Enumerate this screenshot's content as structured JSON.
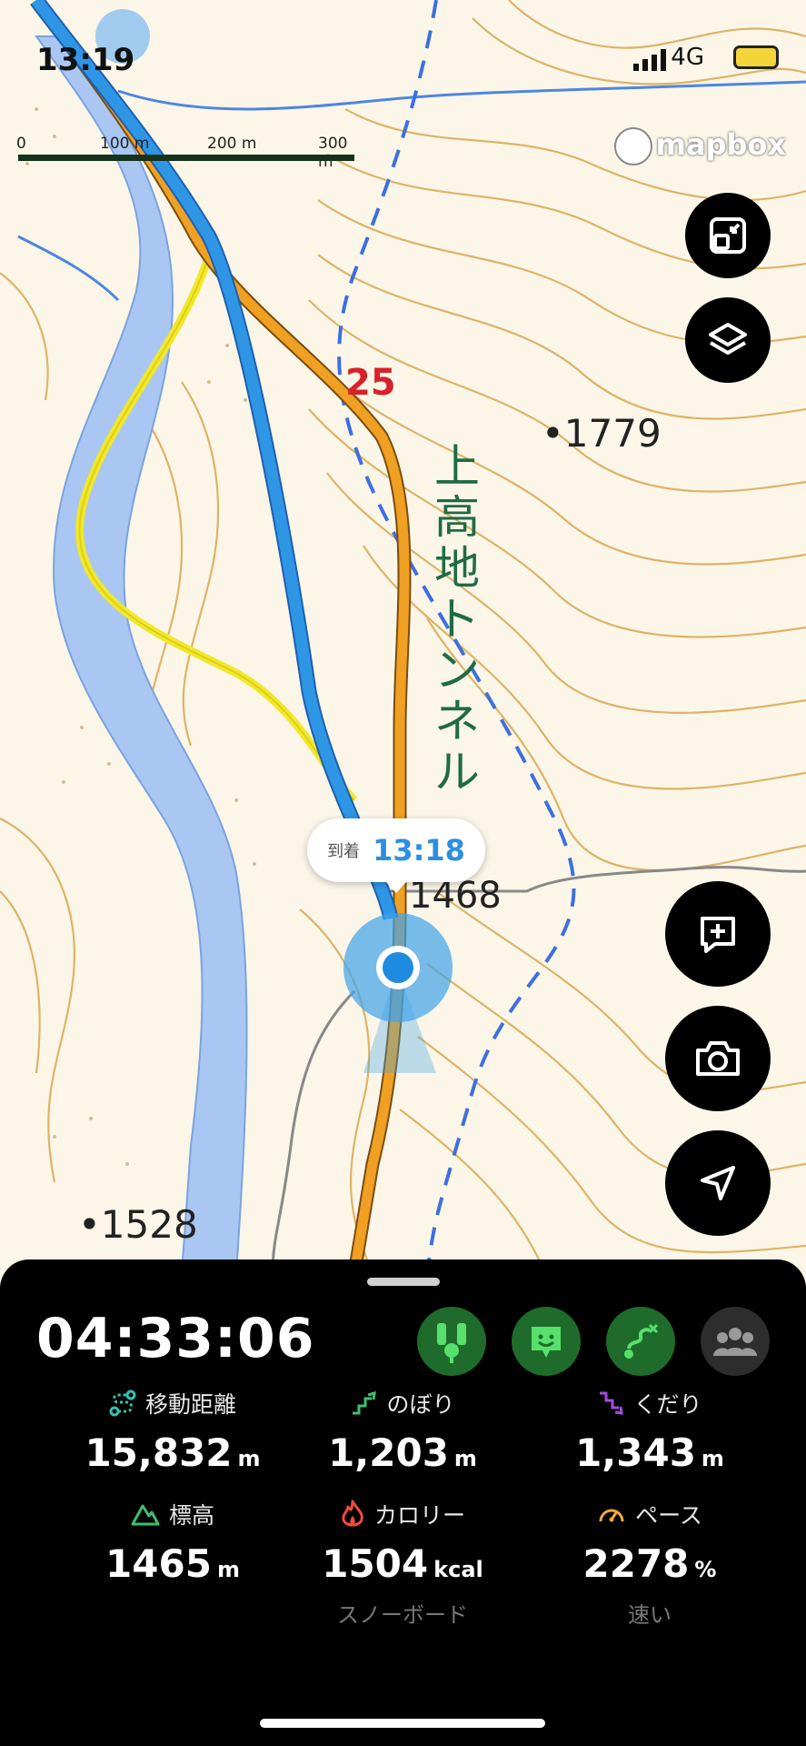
{
  "status_bar": {
    "time": "13:19",
    "network": "4G"
  },
  "scale_bar": {
    "labels": [
      "0",
      "100 m",
      "200 m",
      "300 m"
    ]
  },
  "map": {
    "attribution": "mapbox",
    "labels": {
      "route_number": "25",
      "elevation_1": "•1779",
      "elevation_2": "1468",
      "elevation_3": "•1528",
      "place_name": "上高地トンネル"
    },
    "arrival": {
      "label": "到着",
      "time": "13:18"
    }
  },
  "controls": [
    "fit-route",
    "layers",
    "add-note",
    "camera",
    "locate"
  ],
  "panel": {
    "elapsed_time": "04:33:06",
    "activity_modes": [
      "trail-mode",
      "face-mode",
      "route-mode",
      "group-mode"
    ],
    "stats": [
      {
        "icon": "distance-icon",
        "label": "移動距離",
        "value": "15,832",
        "unit": "m",
        "sub": "",
        "color": "#33c2b4"
      },
      {
        "icon": "ascent-icon",
        "label": "のぼり",
        "value": "1,203",
        "unit": "m",
        "sub": "",
        "color": "#3fbf6f"
      },
      {
        "icon": "descent-icon",
        "label": "くだり",
        "value": "1,343",
        "unit": "m",
        "sub": "",
        "color": "#a34de0"
      },
      {
        "icon": "mountain-icon",
        "label": "標高",
        "value": "1465",
        "unit": "m",
        "sub": "",
        "color": "#3fbf6f"
      },
      {
        "icon": "flame-icon",
        "label": "カロリー",
        "value": "1504",
        "unit": "kcal",
        "sub": "スノーボード",
        "color": "#ef4b3c"
      },
      {
        "icon": "speedometer-icon",
        "label": "ペース",
        "value": "2278",
        "unit": "%",
        "sub": "速い",
        "color": "#f2a93b"
      }
    ]
  }
}
